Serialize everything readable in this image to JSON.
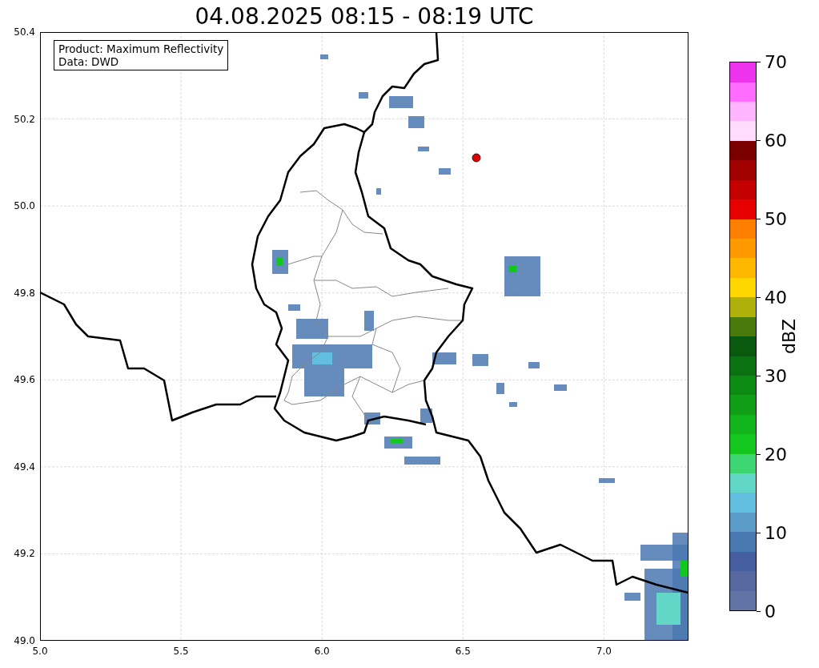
{
  "title": "04.08.2025 08:15 - 08:19 UTC",
  "legend": [
    "Product: Maximum Reflectivity",
    "Data: DWD"
  ],
  "x_ticks": [
    "5.0",
    "5.5",
    "6.0",
    "6.5",
    "7.0"
  ],
  "y_ticks": [
    "50.4",
    "50.2",
    "50.0",
    "49.8",
    "49.6",
    "49.4",
    "49.2",
    "49.0"
  ],
  "colorbar": {
    "label": "dBZ",
    "ticks": [
      "70",
      "60",
      "50",
      "40",
      "30",
      "20",
      "10",
      "0"
    ],
    "bands": [
      {
        "color": "#6274a6"
      },
      {
        "color": "#5869a2"
      },
      {
        "color": "#455fa0"
      },
      {
        "color": "#4a78b0"
      },
      {
        "color": "#5b9cc8"
      },
      {
        "color": "#62bfe0"
      },
      {
        "color": "#62d7c7"
      },
      {
        "color": "#3ed673"
      },
      {
        "color": "#14c71e"
      },
      {
        "color": "#11b51b"
      },
      {
        "color": "#0f9e15"
      },
      {
        "color": "#0c8a12"
      },
      {
        "color": "#0a7210"
      },
      {
        "color": "#095a0e"
      },
      {
        "color": "#4a7a0c"
      },
      {
        "color": "#b0b00a"
      },
      {
        "color": "#ffd700"
      },
      {
        "color": "#ffb700"
      },
      {
        "color": "#ff9900"
      },
      {
        "color": "#ff7f00"
      },
      {
        "color": "#e60000"
      },
      {
        "color": "#c40000"
      },
      {
        "color": "#a00000"
      },
      {
        "color": "#7a0000"
      },
      {
        "color": "#ffdcff"
      },
      {
        "color": "#ffb4ff"
      },
      {
        "color": "#ff6cff"
      },
      {
        "color": "#ee33ee"
      }
    ]
  }
}
